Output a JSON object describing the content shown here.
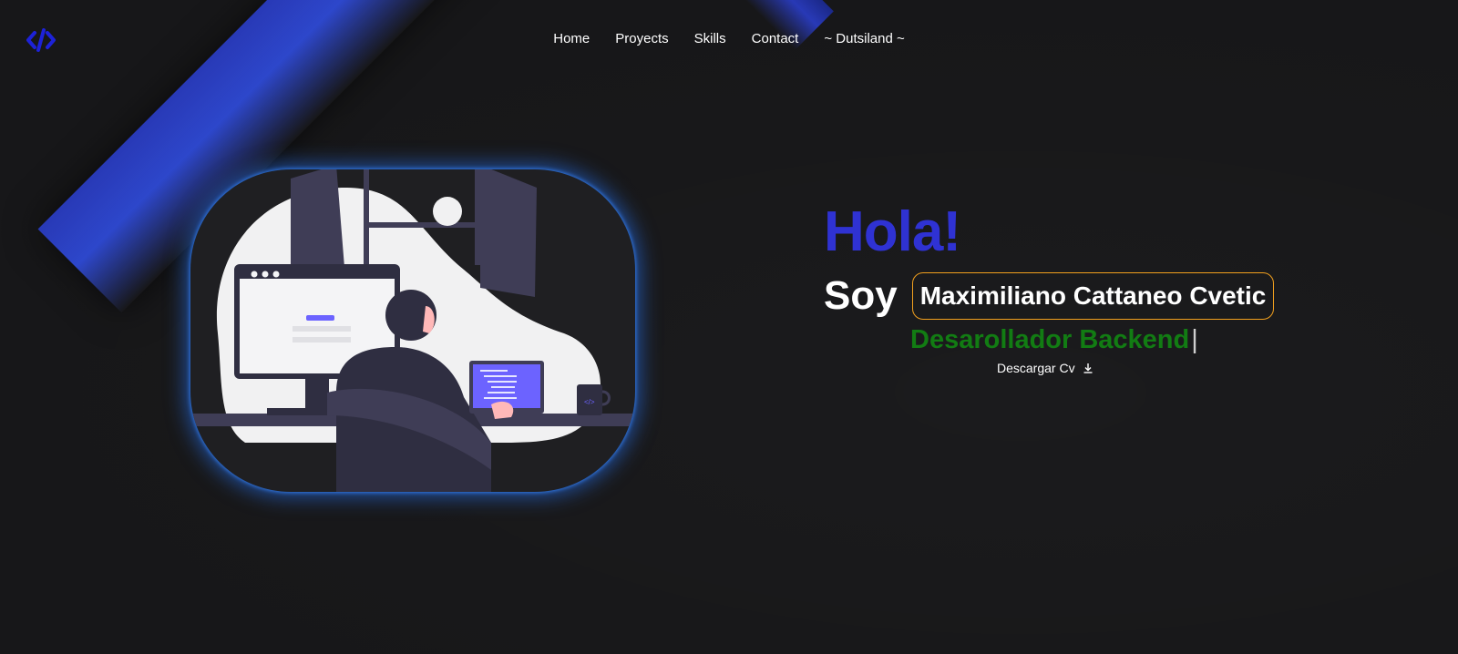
{
  "nav": {
    "logo_icon": "code-brackets-icon",
    "links": [
      {
        "label": "Home"
      },
      {
        "label": "Proyects"
      },
      {
        "label": "Skills"
      },
      {
        "label": "Contact"
      },
      {
        "label": "~ Dutsiland ~"
      }
    ]
  },
  "hero": {
    "greeting": "Hola!",
    "intro": "Soy",
    "name": "Maximiliano Cattaneo Cvetic",
    "role": "Desarollador Backend",
    "caret": "|",
    "cv_label": "Descargar Cv",
    "cv_icon": "download-icon",
    "illustration": "developer-at-desk-illustration"
  },
  "colors": {
    "background": "#1b1b1d",
    "accent_blue": "#2f32d3",
    "name_border": "#f2a01e",
    "role_green": "#127c13",
    "glow": "#2878ff"
  }
}
